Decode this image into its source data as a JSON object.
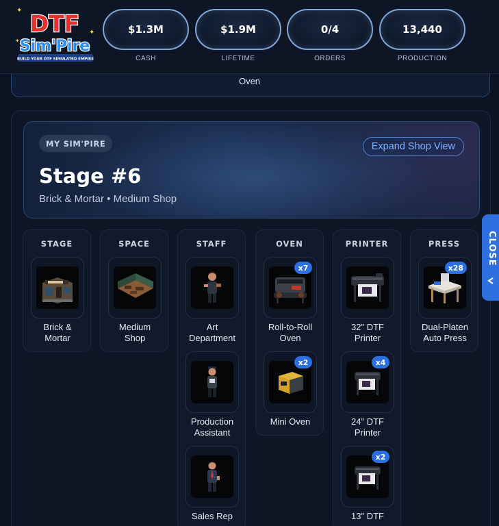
{
  "logo": {
    "line1": "DTF",
    "line2": "Sim'Pire",
    "tagline": "BUILD YOUR DTF SIMULATED EMPIRE"
  },
  "stats": [
    {
      "value": "$1.3M",
      "label": "CASH"
    },
    {
      "value": "$1.9M",
      "label": "LIFETIME"
    },
    {
      "value": "0/4",
      "label": "ORDERS"
    },
    {
      "value": "13,440",
      "label": "PRODUCTION"
    }
  ],
  "upper_panel": {
    "visible_text": "Oven"
  },
  "stage": {
    "badge": "MY SIM'PIRE",
    "expand_label": "Expand Shop View",
    "title": "Stage #6",
    "subtitle": "Brick & Mortar • Medium Shop"
  },
  "columns": [
    {
      "header": "STAGE",
      "items": [
        {
          "label": "Brick & Mortar",
          "icon": "storefront-icon",
          "count": ""
        }
      ]
    },
    {
      "header": "SPACE",
      "items": [
        {
          "label": "Medium Shop",
          "icon": "workshop-room-icon",
          "count": ""
        }
      ]
    },
    {
      "header": "STAFF",
      "items": [
        {
          "label": "Art Department",
          "icon": "artist-staff-icon",
          "count": ""
        },
        {
          "label": "Production Assistant",
          "icon": "assistant-staff-icon",
          "count": ""
        },
        {
          "label": "Sales Rep",
          "icon": "sales-staff-icon",
          "count": ""
        }
      ]
    },
    {
      "header": "OVEN",
      "items": [
        {
          "label": "Roll-to-Roll Oven",
          "icon": "roll-oven-icon",
          "count": "x7"
        },
        {
          "label": "Mini Oven",
          "icon": "mini-oven-icon",
          "count": "x2"
        }
      ]
    },
    {
      "header": "PRINTER",
      "items": [
        {
          "label": "32\" DTF Printer",
          "icon": "large-printer-icon",
          "count": ""
        },
        {
          "label": "24\" DTF Printer",
          "icon": "medium-printer-icon",
          "count": "x4"
        },
        {
          "label": "13\" DTF",
          "icon": "small-printer-icon",
          "count": "x2"
        }
      ]
    },
    {
      "header": "PRESS",
      "items": [
        {
          "label": "Dual-Platen Auto Press",
          "icon": "heat-press-icon",
          "count": "x28"
        }
      ]
    }
  ],
  "close_tab": {
    "label": "CLOSE"
  },
  "colors": {
    "accent": "#2f6fe0",
    "badge_blue": "#2c6fe0",
    "pill_border": "#7fa7d9",
    "link_blue": "#7fb0ff"
  }
}
